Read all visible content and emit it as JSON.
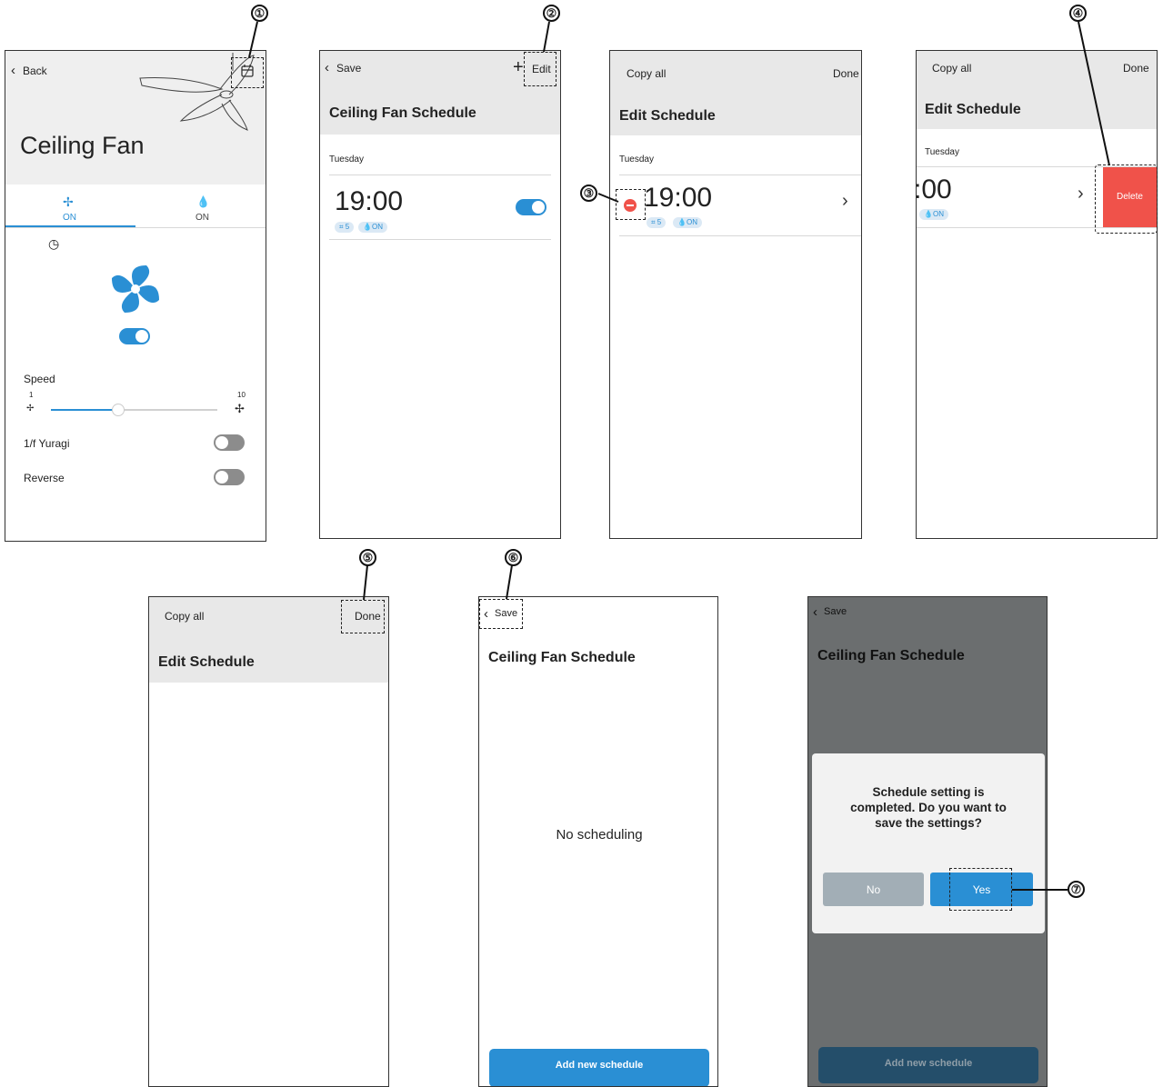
{
  "callouts": [
    "①",
    "②",
    "③",
    "④",
    "⑤",
    "⑥",
    "⑦"
  ],
  "screen1": {
    "back": "Back",
    "title": "Ceiling Fan",
    "tab_fan_state": "ON",
    "tab_light_state": "ON",
    "speed_label": "Speed",
    "speed_min": "1",
    "speed_max": "10",
    "speed_level": 0.4,
    "yuragi_label": "1/f Yuragi",
    "reverse_label": "Reverse",
    "fan_power_on": true,
    "yuragi_on": false,
    "reverse_on": false
  },
  "screen2": {
    "save": "Save",
    "plus": "+",
    "edit": "Edit",
    "title": "Ceiling Fan Schedule",
    "day": "Tuesday",
    "time": "19:00",
    "fan_badge": "5",
    "light_badge": "ON",
    "enabled": true
  },
  "screen3": {
    "copy_all": "Copy all",
    "done": "Done",
    "title": "Edit Schedule",
    "day": "Tuesday",
    "time": "19:00",
    "fan_badge": "5",
    "light_badge": "ON",
    "chevron": "›"
  },
  "screen4": {
    "copy_all": "Copy all",
    "done": "Done",
    "title": "Edit Schedule",
    "day": "Tuesday",
    "time": ":00",
    "light_badge": "ON",
    "chevron": "›",
    "delete": "Delete"
  },
  "screen5": {
    "copy_all": "Copy all",
    "done": "Done",
    "title": "Edit Schedule"
  },
  "screen6": {
    "save": "Save",
    "title": "Ceiling Fan Schedule",
    "empty": "No scheduling",
    "add_button": "Add new schedule"
  },
  "screen7": {
    "save": "Save",
    "title": "Ceiling Fan Schedule",
    "dialog_text": "Schedule setting is completed. Do you want to save the settings?",
    "no": "No",
    "yes": "Yes",
    "add_button": "Add new schedule"
  },
  "colors": {
    "accent": "#2a8fd4",
    "delete": "#f0524a",
    "header_bg": "#e8e8e8",
    "overlay": "#6b6e6f",
    "no_button": "#a2aeb6"
  }
}
